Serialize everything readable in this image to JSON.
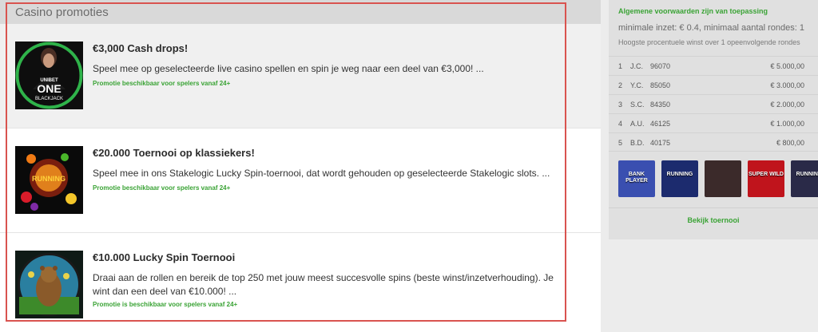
{
  "header": {
    "title": "Casino promoties"
  },
  "promos": [
    {
      "title": "€3,000 Cash drops!",
      "description": "Speel mee op geselecteerde live casino spellen en spin je weg naar een deel van €3,000! ...",
      "note": "Promotie beschikbaar voor spelers vanaf 24+",
      "thumb_text_1": "UNIBET",
      "thumb_text_2": "ONE",
      "thumb_text_3": "BLACKJACK"
    },
    {
      "title": "€20.000 Toernooi op klassiekers!",
      "description": "Speel mee in ons Stakelogic Lucky Spin-toernooi, dat wordt gehouden op geselecteerde Stakelogic slots. ...",
      "note": "Promotie beschikbaar voor spelers vanaf 24+",
      "thumb_text_1": "RUNNING"
    },
    {
      "title": "€10.000 Lucky Spin Toernooi",
      "description": "Draai aan de rollen en bereik de top 250 met jouw meest succesvolle spins (beste winst/inzetverhouding). Je wint dan een deel van €10.000! ...",
      "note": "Promotie is beschikbaar voor spelers vanaf 24+"
    }
  ],
  "sidebar": {
    "terms_link": "Algemene voorwaarden zijn van toepassing",
    "min_bet": "minimale inzet: € 0.4, minimaal aantal rondes: 1",
    "highest_win": "Hoogste procentuele winst over 1 opeenvolgende rondes",
    "leaderboard": [
      {
        "rank": "1",
        "name": "J.C.",
        "score": "96070",
        "prize": "€ 5.000,00"
      },
      {
        "rank": "2",
        "name": "Y.C.",
        "score": "85050",
        "prize": "€ 3.000,00"
      },
      {
        "rank": "3",
        "name": "S.C.",
        "score": "84350",
        "prize": "€ 2.000,00"
      },
      {
        "rank": "4",
        "name": "A.U.",
        "score": "46125",
        "prize": "€ 1.000,00"
      },
      {
        "rank": "5",
        "name": "B.D.",
        "score": "40175",
        "prize": "€ 800,00"
      }
    ],
    "games": [
      {
        "label": "BANK PLAYER",
        "color": "#3a4fb0"
      },
      {
        "label": "RUNNING",
        "color": "#1c2b6e"
      },
      {
        "label": "",
        "color": "#3b2a2a"
      },
      {
        "label": "SUPER WILD",
        "color": "#c0141c"
      },
      {
        "label": "RUNNING",
        "color": "#2a2a48"
      }
    ],
    "view_button": "Bekijk toernooi"
  }
}
